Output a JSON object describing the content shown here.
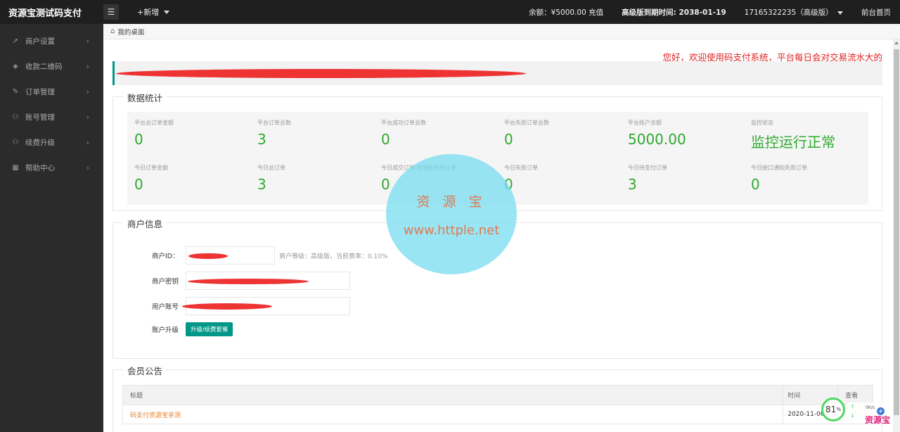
{
  "header": {
    "brand": "资源宝测试码支付",
    "menu_toggle_icon": "list-icon",
    "add_label": "+新增",
    "balance": "余额：¥5000.00 充值",
    "expiry": "高级版到期时间: 2038-01-19",
    "account": "17165322235（高级版）",
    "home_link": "前台首页"
  },
  "sidebar": {
    "items": [
      {
        "label": "商户设置",
        "icon": "send-icon"
      },
      {
        "label": "收款二维码",
        "icon": "cube-icon"
      },
      {
        "label": "订单管理",
        "icon": "edit-icon"
      },
      {
        "label": "账号管理",
        "icon": "user-icon"
      },
      {
        "label": "续费升级",
        "icon": "user-icon"
      },
      {
        "label": "帮助中心",
        "icon": "grid-icon"
      }
    ]
  },
  "breadcrumb": {
    "label": "我的桌面"
  },
  "welcome_text": "您好，欢迎使用码支付系统，平台每日会对交易流水大的",
  "stats_section": {
    "legend": "数据统计",
    "items": [
      {
        "label": "平台总订单金额",
        "value": "0"
      },
      {
        "label": "平台订单总数",
        "value": "3"
      },
      {
        "label": "平台成功订单总数",
        "value": "0"
      },
      {
        "label": "平台失败订单总数",
        "value": "0"
      },
      {
        "label": "平台账户余额",
        "value": "5000.00"
      },
      {
        "label": "监控状态",
        "value": "监控运行正常"
      },
      {
        "label": "今日订单金额",
        "value": "0"
      },
      {
        "label": "今日总订单",
        "value": "3"
      },
      {
        "label": "今日成交订单/含通知失败订单",
        "value": "0"
      },
      {
        "label": "今日失败订单",
        "value": "0"
      },
      {
        "label": "今日待支付订单",
        "value": "3"
      },
      {
        "label": "今日接口通知失败订单",
        "value": "0"
      }
    ]
  },
  "merchant_section": {
    "legend": "商户信息",
    "id_label": "商户ID：",
    "id_aux": "商户等级：高级版，当前费率：0.10%",
    "key_label": "商户密钥",
    "account_label": "用户账号",
    "upgrade_label": "账户升级",
    "upgrade_button": "升级/续费套餐"
  },
  "announcement_section": {
    "legend": "会员公告",
    "columns": [
      "标题",
      "时间",
      "查看"
    ],
    "rows": [
      {
        "title": "码支付资源宝亲测",
        "time": "2020-11-06"
      }
    ]
  },
  "watermark": {
    "line1": "资 源 宝",
    "line2": "www.httple.net"
  },
  "speed_widget": {
    "percent": "81",
    "unit": "%",
    "rate": "0K/s",
    "logo": "资源宝"
  }
}
